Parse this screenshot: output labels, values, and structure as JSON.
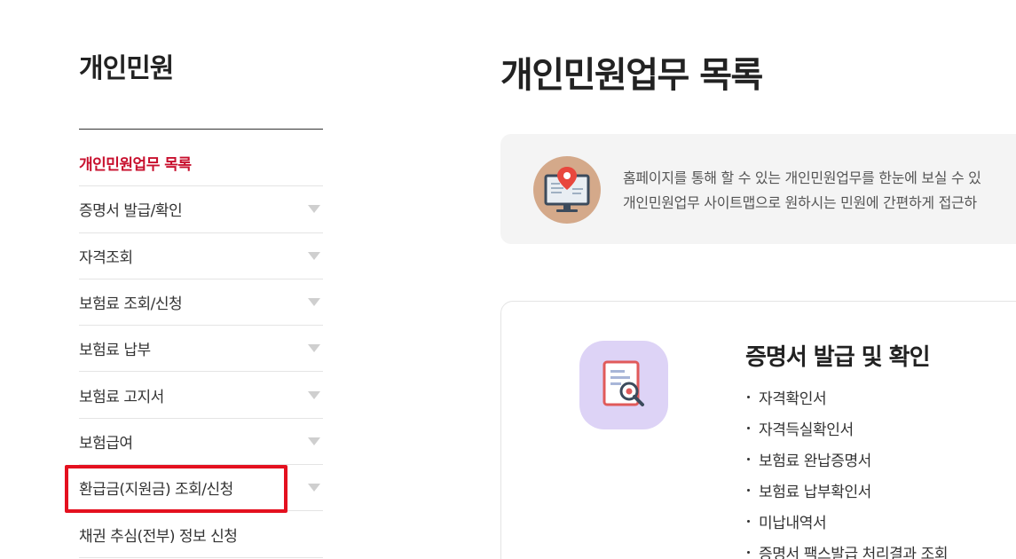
{
  "sidebar": {
    "title": "개인민원",
    "items": [
      {
        "label": "개인민원업무 목록",
        "active": true,
        "has_caret": false
      },
      {
        "label": "증명서 발급/확인",
        "active": false,
        "has_caret": true
      },
      {
        "label": "자격조회",
        "active": false,
        "has_caret": true
      },
      {
        "label": "보험료 조회/신청",
        "active": false,
        "has_caret": true
      },
      {
        "label": "보험료 납부",
        "active": false,
        "has_caret": true
      },
      {
        "label": "보험료 고지서",
        "active": false,
        "has_caret": true
      },
      {
        "label": "보험급여",
        "active": false,
        "has_caret": true
      },
      {
        "label": "환급금(지원금) 조회/신청",
        "active": false,
        "has_caret": true,
        "highlighted": true
      },
      {
        "label": "채권 추심(전부) 정보 신청",
        "active": false,
        "has_caret": false
      }
    ]
  },
  "main": {
    "title": "개인민원업무 목록",
    "intro": {
      "icon": "monitor-location-pin-icon",
      "line1": "홈페이지를 통해 할 수 있는 개인민원업무를 한눈에 보실 수 있",
      "line2": "개인민원업무 사이트맵으로 원하시는 민원에 간편하게 접근하"
    },
    "card": {
      "icon": "document-magnifier-icon",
      "title": "증명서 발급 및 확인",
      "links": [
        "자격확인서",
        "자격득실확인서",
        "보험료 완납증명서",
        "보험료 납부확인서",
        "미납내역서",
        "증명서 팩스발급 처리결과 조회"
      ]
    }
  },
  "colors": {
    "accent": "#c8102e",
    "highlight_border": "#e4101f",
    "intro_bg": "#f4f4f4",
    "intro_icon_bg": "#d4a98a",
    "card_icon_bg": "#ddd3f6"
  }
}
